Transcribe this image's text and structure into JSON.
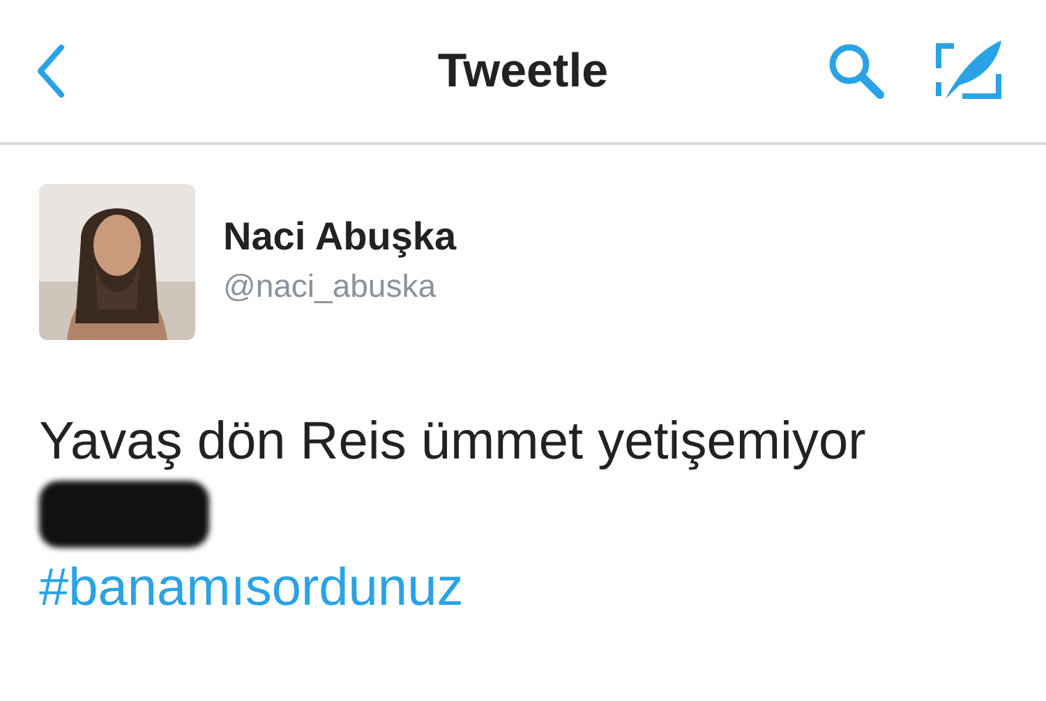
{
  "nav_bar": {
    "title": "Tweetle"
  },
  "tweet": {
    "author": {
      "name": "Naci Abuşka",
      "handle": "@naci_abuska"
    },
    "text": "Yavaş dön Reis ümmet yetişemiyor",
    "redacted": true,
    "hashtag": "#banamısordunuz"
  }
}
